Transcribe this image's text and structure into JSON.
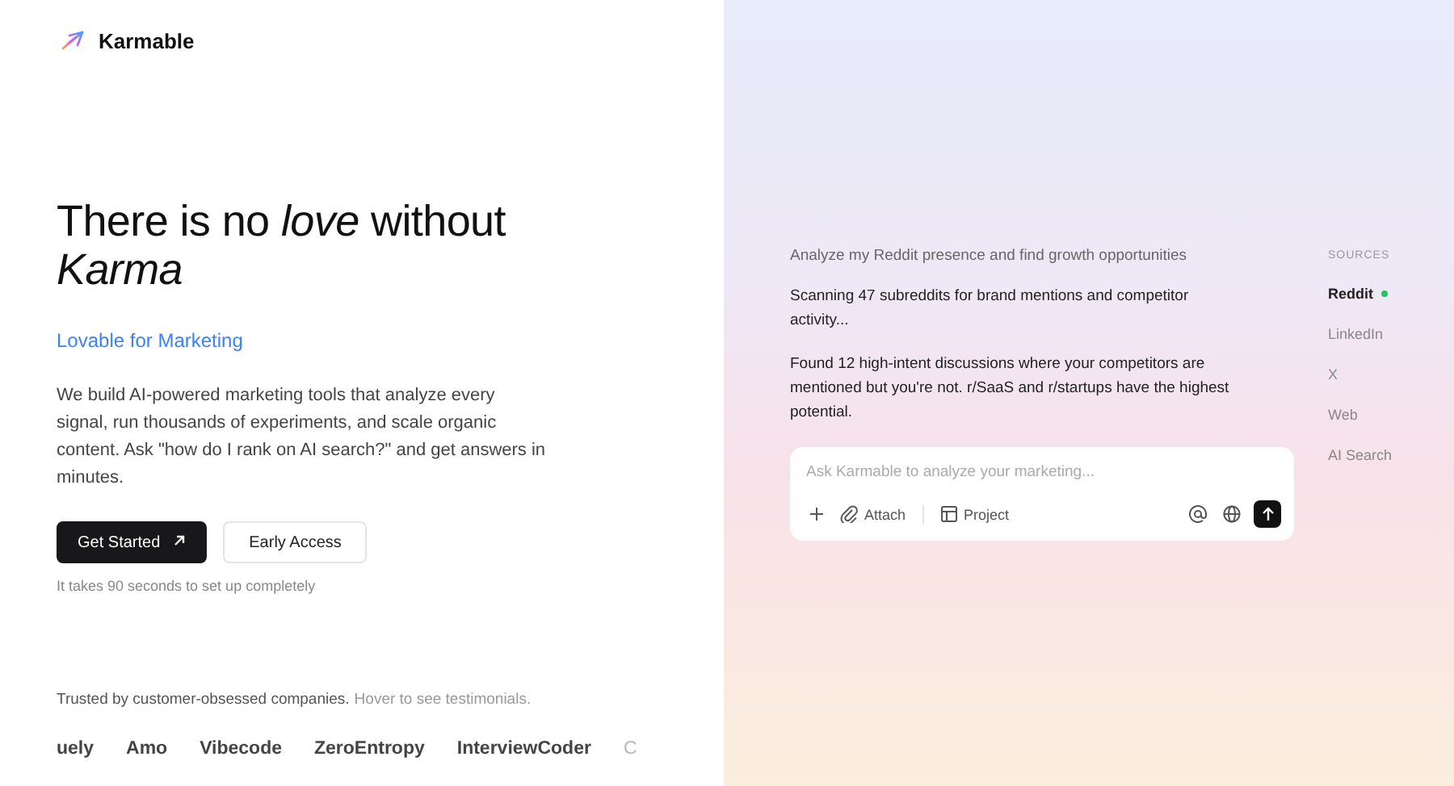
{
  "brand": {
    "name": "Karmable"
  },
  "hero": {
    "headline": "There is no *love* without *Karma*",
    "tagline": "Lovable for Marketing",
    "description": "We build AI-powered marketing tools that analyze every signal, run thousands of experiments, and scale organic content. Ask \"how do I rank on AI search?\" and get answers in minutes.",
    "buttons": [
      {
        "label": "Get Started",
        "kind": "primary"
      },
      {
        "label": "Early Access",
        "kind": "secondary"
      }
    ],
    "note": "It takes 90 seconds to set up completely"
  },
  "trust": {
    "text": "Trusted by customer-obsessed companies.",
    "hint": "Hover to see testimonials.",
    "logos": [
      {
        "name": "uely",
        "faded": false
      },
      {
        "name": "Amo",
        "faded": false
      },
      {
        "name": "Vibecode",
        "faded": false
      },
      {
        "name": "ZeroEntropy",
        "faded": false
      },
      {
        "name": "InterviewCoder",
        "faded": false
      },
      {
        "name": "C",
        "faded": true
      }
    ]
  },
  "chat": {
    "prompt": "Analyze my Reddit presence and find growth opportunities",
    "messages": [
      "Scanning 47 subreddits for brand mentions and competitor activity...",
      "Found 12 high-intent discussions where your competitors are mentioned but you're not. r/SaaS and r/startups have the highest potential."
    ],
    "input": {
      "placeholder": "Ask Karmable to analyze your marketing...",
      "actions": [
        "Attach",
        "Project"
      ]
    }
  },
  "sources": {
    "heading": "SOURCES",
    "items": [
      {
        "label": "Reddit",
        "selected": true
      },
      {
        "label": "LinkedIn",
        "selected": false
      },
      {
        "label": "X",
        "selected": false
      },
      {
        "label": "Web",
        "selected": false
      },
      {
        "label": "AI Search",
        "selected": false
      }
    ]
  }
}
